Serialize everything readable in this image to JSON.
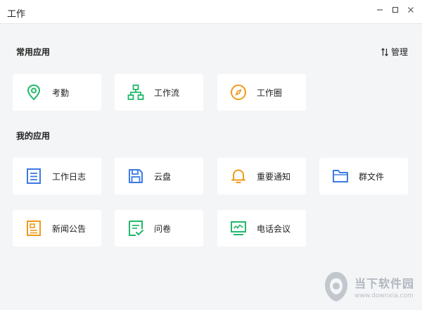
{
  "window": {
    "title": "工作"
  },
  "sections": {
    "common": {
      "title": "常用应用",
      "manage_label": "管理"
    },
    "mine": {
      "title": "我的应用"
    }
  },
  "common_apps": [
    {
      "label": "考勤",
      "icon": "location-pin-icon",
      "color": "#21b86b"
    },
    {
      "label": "工作流",
      "icon": "org-chart-icon",
      "color": "#21b86b"
    },
    {
      "label": "工作圈",
      "icon": "compass-icon",
      "color": "#f09a1a"
    }
  ],
  "my_apps": [
    {
      "label": "工作日志",
      "icon": "document-icon",
      "color": "#3c7ae6"
    },
    {
      "label": "云盘",
      "icon": "floppy-disk-icon",
      "color": "#3c7ae6"
    },
    {
      "label": "重要通知",
      "icon": "bell-icon",
      "color": "#f09a1a"
    },
    {
      "label": "群文件",
      "icon": "folder-icon",
      "color": "#3c7ae6"
    },
    {
      "label": "新闻公告",
      "icon": "newspaper-icon",
      "color": "#f09a1a"
    },
    {
      "label": "问卷",
      "icon": "survey-icon",
      "color": "#21b86b"
    },
    {
      "label": "电话会议",
      "icon": "monitor-icon",
      "color": "#21b86b"
    }
  ],
  "watermark": {
    "cn": "当下软件园",
    "en": "www.downxia.com"
  }
}
